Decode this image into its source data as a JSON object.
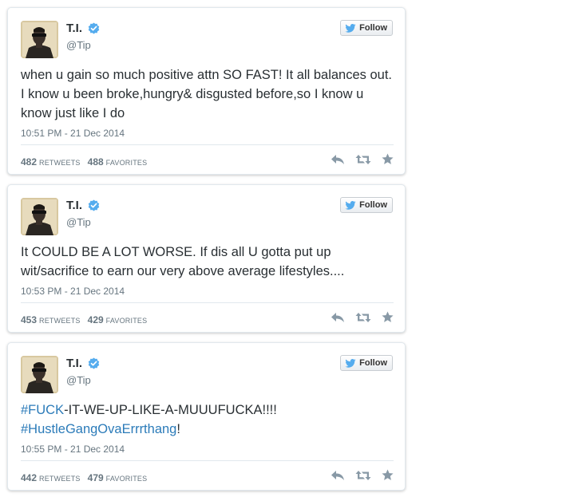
{
  "colors": {
    "verified": "#55acee",
    "twitter_bird": "#55acee",
    "hashtag": "#2b7bb9",
    "text": "#292f33",
    "muted": "#66757f",
    "icon": "#8899a6"
  },
  "tweets": [
    {
      "author": "T.I.",
      "handle": "@Tip",
      "follow_label": "Follow",
      "text": "when u gain so much positive attn SO FAST! It all balances out. I know u been broke,hungry& disgusted before,so I know u know just like I do",
      "timestamp": "10:51 PM - 21 Dec 2014",
      "retweets": "482",
      "retweets_label": "RETWEETS",
      "favorites": "488",
      "favorites_label": "FAVORITES",
      "icons": [
        "verified-badge-icon",
        "twitter-bird-icon",
        "reply-icon",
        "retweet-icon",
        "star-icon"
      ]
    },
    {
      "author": "T.I.",
      "handle": "@Tip",
      "follow_label": "Follow",
      "text": "It COULD BE A LOT WORSE. If dis all U gotta put up wit/sacrifice to earn our very above average lifestyles....",
      "timestamp": "10:53 PM - 21 Dec 2014",
      "retweets": "453",
      "retweets_label": "RETWEETS",
      "favorites": "429",
      "favorites_label": "FAVORITES",
      "icons": [
        "verified-badge-icon",
        "twitter-bird-icon",
        "reply-icon",
        "retweet-icon",
        "star-icon"
      ]
    },
    {
      "author": "T.I.",
      "handle": "@Tip",
      "follow_label": "Follow",
      "hashtag1": "#FUCK",
      "text_after_hashtag1": "-IT-WE-UP-LIKE-A-MUUUFUCKA!!!!",
      "hashtag2": "#HustleGangOvaErrrthang",
      "text_after_hashtag2": "!",
      "timestamp": "10:55 PM - 21 Dec 2014",
      "retweets": "442",
      "retweets_label": "RETWEETS",
      "favorites": "479",
      "favorites_label": "FAVORITES",
      "icons": [
        "verified-badge-icon",
        "twitter-bird-icon",
        "reply-icon",
        "retweet-icon",
        "star-icon"
      ]
    }
  ]
}
